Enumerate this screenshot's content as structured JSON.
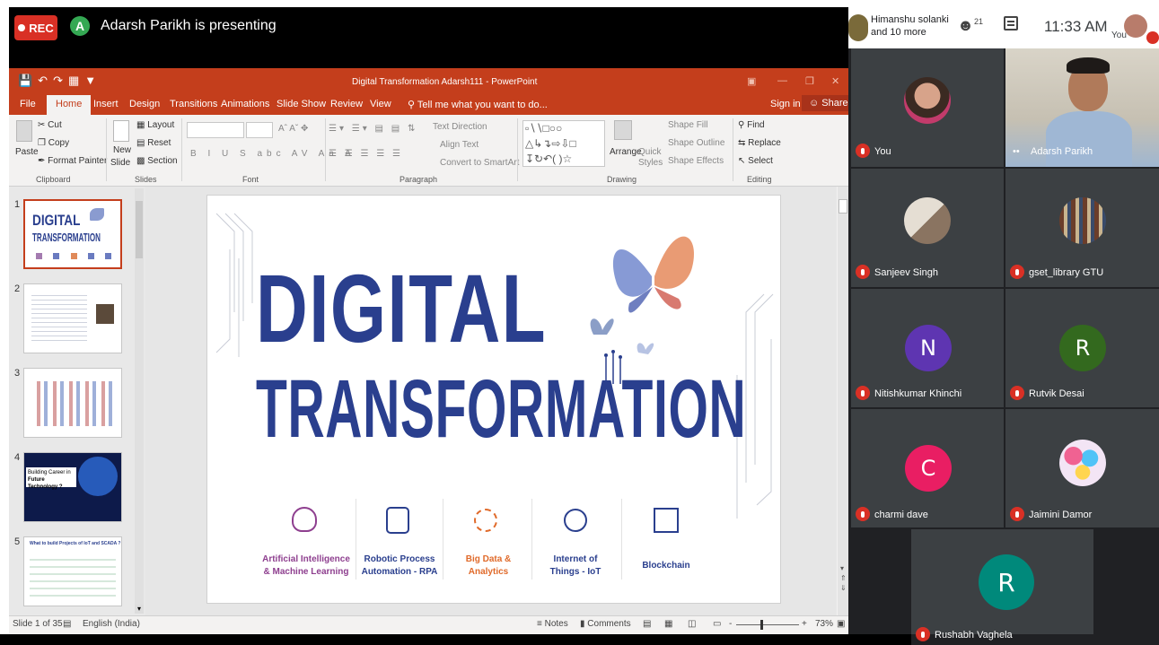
{
  "meet": {
    "rec_label": "REC",
    "presenter_initial": "A",
    "presenting_text": "Adarsh Parikh is presenting",
    "others_line1": "Himanshu solanki",
    "others_line2": "and 10 more",
    "people_count": "21",
    "time": "11:33 AM",
    "you_label": "You"
  },
  "ppt": {
    "doc_title": "Digital Transformation Adarsh111 - PowerPoint",
    "tabs": [
      "File",
      "Home",
      "Insert",
      "Design",
      "Transitions",
      "Animations",
      "Slide Show",
      "Review",
      "View"
    ],
    "tell_me": "Tell me what you want to do...",
    "sign_in": "Sign in",
    "share": "Share",
    "ribbon": {
      "cut": "Cut",
      "copy": "Copy",
      "paste": "Paste",
      "format_painter": "Format Painter",
      "clipboard": "Clipboard",
      "new_slide_1": "New",
      "new_slide_2": "Slide",
      "layout": "Layout",
      "reset": "Reset",
      "section": "Section",
      "slides": "Slides",
      "font_group": "Font",
      "text_direction": "Text Direction",
      "align_text": "Align Text",
      "convert_smartart": "Convert to SmartArt",
      "paragraph": "Paragraph",
      "arrange": "Arrange",
      "quick_styles_1": "Quick",
      "quick_styles_2": "Styles",
      "shape_fill": "Shape Fill",
      "shape_outline": "Shape Outline",
      "shape_effects": "Shape Effects",
      "drawing": "Drawing",
      "find": "Find",
      "replace": "Replace",
      "select": "Select",
      "editing": "Editing"
    },
    "thumbnails": [
      {
        "num": "1",
        "title1": "DIGITAL",
        "title2": "TRANSFORMATION"
      },
      {
        "num": "2"
      },
      {
        "num": "3"
      },
      {
        "num": "4",
        "text1": "Building Career in",
        "text2": "Future Technology ?"
      },
      {
        "num": "5",
        "text1": "What to build Projects of IoT and SCADA ?"
      }
    ],
    "slide": {
      "line1": "DIGITAL",
      "line2": "TRANSFORMATION",
      "features": [
        {
          "label1": "Artificial Intelligence",
          "label2": "& Machine Learning",
          "color": "#8e3f8f"
        },
        {
          "label1": "Robotic Process",
          "label2": "Automation - RPA",
          "color": "#2a3f8e"
        },
        {
          "label1": "Big Data &",
          "label2": "Analytics",
          "color": "#e06a2a"
        },
        {
          "label1": "Internet of",
          "label2": "Things - IoT",
          "color": "#2a3f8e"
        },
        {
          "label1": "Blockchain",
          "label2": "",
          "color": "#2a3f8e"
        }
      ]
    },
    "status": {
      "slide_of": "Slide 1 of 35",
      "language": "English (India)",
      "notes": "Notes",
      "comments": "Comments",
      "zoom": "73%"
    }
  },
  "participants": [
    {
      "name": "You",
      "type": "photo"
    },
    {
      "name": "Adarsh Parikh",
      "type": "video"
    },
    {
      "name": "Sanjeev Singh",
      "type": "photo"
    },
    {
      "name": "gset_library GTU",
      "type": "photo"
    },
    {
      "name": "Nitishkumar Khinchi",
      "type": "letter",
      "letter": "N",
      "color": "#5e35b1"
    },
    {
      "name": "Rutvik Desai",
      "type": "letter",
      "letter": "R",
      "color": "#33691e"
    },
    {
      "name": "charmi dave",
      "type": "letter",
      "letter": "C",
      "color": "#e91e63"
    },
    {
      "name": "Jaimini Damor",
      "type": "photo"
    },
    {
      "name": "Rushabh Vaghela",
      "type": "letter",
      "letter": "R",
      "color": "#00897b"
    }
  ],
  "colors": {
    "ppt_accent": "#c43e1c",
    "slide_title": "#2a3f8e",
    "meet_rec": "#d93025",
    "meet_bg": "#202124"
  }
}
